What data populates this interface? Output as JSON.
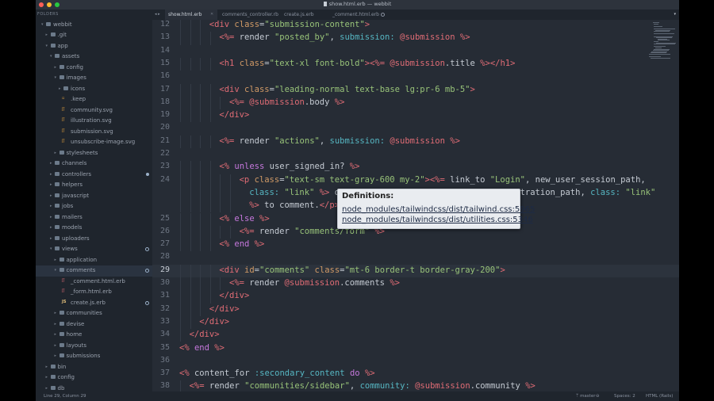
{
  "window": {
    "title": "show.html.erb — webbit"
  },
  "sidebar": {
    "header": "FOLDERS",
    "items": [
      {
        "label": "webbit",
        "kind": "folder",
        "depth": 0,
        "open": true
      },
      {
        "label": ".git",
        "kind": "folder",
        "depth": 1,
        "open": false
      },
      {
        "label": "app",
        "kind": "folder",
        "depth": 1,
        "open": true
      },
      {
        "label": "assets",
        "kind": "folder",
        "depth": 2,
        "open": true
      },
      {
        "label": "config",
        "kind": "folder",
        "depth": 3,
        "open": false
      },
      {
        "label": "images",
        "kind": "folder",
        "depth": 3,
        "open": true
      },
      {
        "label": "icons",
        "kind": "folder",
        "depth": 4,
        "open": false
      },
      {
        "label": ".keep",
        "kind": "file",
        "depth": 4,
        "icon": "file-icon"
      },
      {
        "label": "community.svg",
        "kind": "svg",
        "depth": 4
      },
      {
        "label": "illustration.svg",
        "kind": "svg",
        "depth": 4
      },
      {
        "label": "submission.svg",
        "kind": "svg",
        "depth": 4
      },
      {
        "label": "unsubscribe-image.svg",
        "kind": "svg",
        "depth": 4
      },
      {
        "label": "stylesheets",
        "kind": "folder",
        "depth": 3,
        "open": false
      },
      {
        "label": "channels",
        "kind": "folder",
        "depth": 2,
        "open": false
      },
      {
        "label": "controllers",
        "kind": "folder",
        "depth": 2,
        "open": false,
        "mark": "filled"
      },
      {
        "label": "helpers",
        "kind": "folder",
        "depth": 2,
        "open": false
      },
      {
        "label": "javascript",
        "kind": "folder",
        "depth": 2,
        "open": false
      },
      {
        "label": "jobs",
        "kind": "folder",
        "depth": 2,
        "open": false
      },
      {
        "label": "mailers",
        "kind": "folder",
        "depth": 2,
        "open": false
      },
      {
        "label": "models",
        "kind": "folder",
        "depth": 2,
        "open": false
      },
      {
        "label": "uploaders",
        "kind": "folder",
        "depth": 2,
        "open": false
      },
      {
        "label": "views",
        "kind": "folder",
        "depth": 2,
        "open": true,
        "mark": "hollow"
      },
      {
        "label": "application",
        "kind": "folder",
        "depth": 3,
        "open": false
      },
      {
        "label": "comments",
        "kind": "folder",
        "depth": 3,
        "open": true,
        "mark": "hollow",
        "selected": true
      },
      {
        "label": "_comment.html.erb",
        "kind": "erb",
        "depth": 4
      },
      {
        "label": "_form.html.erb",
        "kind": "erb",
        "depth": 4
      },
      {
        "label": "create.js.erb",
        "kind": "js",
        "depth": 4,
        "mark": "hollow"
      },
      {
        "label": "communities",
        "kind": "folder",
        "depth": 3,
        "open": false
      },
      {
        "label": "devise",
        "kind": "folder",
        "depth": 3,
        "open": false
      },
      {
        "label": "home",
        "kind": "folder",
        "depth": 3,
        "open": false
      },
      {
        "label": "layouts",
        "kind": "folder",
        "depth": 3,
        "open": false
      },
      {
        "label": "submissions",
        "kind": "folder",
        "depth": 3,
        "open": false
      },
      {
        "label": "bin",
        "kind": "folder",
        "depth": 1,
        "open": false
      },
      {
        "label": "config",
        "kind": "folder",
        "depth": 1,
        "open": false
      },
      {
        "label": "db",
        "kind": "folder",
        "depth": 1,
        "open": false
      }
    ]
  },
  "tabs": [
    {
      "label": "show.html.erb",
      "active": true
    },
    {
      "label": "comments_controller.rb",
      "active": false
    },
    {
      "label": "create.js.erb",
      "active": false
    },
    {
      "label": "_comment.html.erb",
      "active": false,
      "dirty": true
    }
  ],
  "editor": {
    "current_line": "29",
    "lines": [
      {
        "n": "12",
        "indent": 3,
        "html": "<span class=\"tg\">&lt;div</span> <span class=\"at\">class</span>=<span class=\"st\">\"submission-content\"</span><span class=\"tg\">&gt;</span>"
      },
      {
        "n": "13",
        "indent": 4,
        "html": "<span class=\"er\">&lt;%=</span> render <span class=\"st\">\"posted_by\"</span>, <span class=\"sy\">submission:</span> <span class=\"iv\">@submission</span> <span class=\"er\">%&gt;</span>"
      },
      {
        "n": "14",
        "indent": 0,
        "html": ""
      },
      {
        "n": "15",
        "indent": 4,
        "html": "<span class=\"tg\">&lt;h1</span> <span class=\"at\">class</span>=<span class=\"st\">\"text-xl font-bold\"</span><span class=\"tg\">&gt;</span><span class=\"er\">&lt;%=</span> <span class=\"iv\">@submission</span>.title <span class=\"er\">%&gt;</span><span class=\"tg\">&lt;/h1&gt;</span>"
      },
      {
        "n": "16",
        "indent": 0,
        "html": ""
      },
      {
        "n": "17",
        "indent": 4,
        "html": "<span class=\"tg\">&lt;div</span> <span class=\"at\">class</span>=<span class=\"st\">\"leading-normal text-base lg:pr-6 mb-5\"</span><span class=\"tg\">&gt;</span>"
      },
      {
        "n": "18",
        "indent": 5,
        "html": "<span class=\"er\">&lt;%=</span> <span class=\"iv\">@submission</span>.body <span class=\"er\">%&gt;</span>"
      },
      {
        "n": "19",
        "indent": 4,
        "html": "<span class=\"tg\">&lt;/div&gt;</span>"
      },
      {
        "n": "20",
        "indent": 0,
        "html": ""
      },
      {
        "n": "21",
        "indent": 4,
        "html": "<span class=\"er\">&lt;%=</span> render <span class=\"st\">\"actions\"</span>, <span class=\"sy\">submission:</span> <span class=\"iv\">@submission</span> <span class=\"er\">%&gt;</span>"
      },
      {
        "n": "22",
        "indent": 0,
        "html": ""
      },
      {
        "n": "23",
        "indent": 4,
        "html": "<span class=\"er\">&lt;%</span> <span class=\"kw\">unless</span> user_signed_in? <span class=\"er\">%&gt;</span>"
      },
      {
        "n": "24",
        "indent": 6,
        "html": "<span class=\"tg\">&lt;p</span> <span class=\"at\">class</span>=<span class=\"st\">\"text-sm text-gray-600 my-2\"</span><span class=\"tg\">&gt;</span><span class=\"er\">&lt;%=</span> link_to <span class=\"st\">\"Login\"</span>, new_user_session_path,"
      },
      {
        "n": "",
        "indent": 7,
        "html": "<span class=\"sy\">class:</span> <span class=\"st\">\"link\"</span> <span class=\"er\">%&gt;</span> or                                   tration_path, <span class=\"sy\">class:</span> <span class=\"st\">\"link\"</span>"
      },
      {
        "n": "",
        "indent": 7,
        "html": "<span class=\"er\">%&gt;</span> to comment.<span class=\"tg\">&lt;/p&gt;</span>"
      },
      {
        "n": "25",
        "indent": 4,
        "html": "<span class=\"er\">&lt;%</span> <span class=\"kw\">else</span> <span class=\"er\">%&gt;</span>"
      },
      {
        "n": "26",
        "indent": 6,
        "html": "<span class=\"er\">&lt;%=</span> render <span class=\"st\">\"comments/form\"</span> <span class=\"er\">%&gt;</span>"
      },
      {
        "n": "27",
        "indent": 4,
        "html": "<span class=\"er\">&lt;%</span> <span class=\"kw\">end</span> <span class=\"er\">%&gt;</span>"
      },
      {
        "n": "28",
        "indent": 0,
        "html": ""
      },
      {
        "n": "29",
        "indent": 4,
        "html": "<span class=\"tg\">&lt;div</span> <span class=\"at\">id</span>=<span class=\"st\">\"comments\"</span> <span class=\"at\">class</span>=<span class=\"st\">\"mt-6 border-t border-gray-200\"</span><span class=\"tg\">&gt;</span>"
      },
      {
        "n": "30",
        "indent": 5,
        "html": "<span class=\"er\">&lt;%=</span> render <span class=\"iv\">@submission</span>.comments <span class=\"er\">%&gt;</span>"
      },
      {
        "n": "31",
        "indent": 4,
        "html": "<span class=\"tg\">&lt;/div&gt;</span>"
      },
      {
        "n": "32",
        "indent": 3,
        "html": "<span class=\"tg\">&lt;/div&gt;</span>"
      },
      {
        "n": "33",
        "indent": 2,
        "html": "<span class=\"tg\">&lt;/div&gt;</span>"
      },
      {
        "n": "34",
        "indent": 1,
        "html": "<span class=\"tg\">&lt;/div&gt;</span>"
      },
      {
        "n": "35",
        "indent": 0,
        "html": "<span class=\"er\">&lt;%</span> <span class=\"kw\">end</span> <span class=\"er\">%&gt;</span>"
      },
      {
        "n": "36",
        "indent": 0,
        "html": ""
      },
      {
        "n": "37",
        "indent": 0,
        "html": "<span class=\"er\">&lt;%</span> content_for <span class=\"sy\">:secondary_content</span> <span class=\"kw\">do</span> <span class=\"er\">%&gt;</span>"
      },
      {
        "n": "38",
        "indent": 1,
        "html": "<span class=\"er\">&lt;%=</span> render <span class=\"st\">\"communities/sidebar\"</span>, <span class=\"sy\">community:</span> <span class=\"iv\">@submission</span>.community <span class=\"er\">%&gt;</span>"
      }
    ]
  },
  "tooltip": {
    "title": "Definitions:",
    "links": [
      "node_modules/tailwindcss/dist/tailwind.css:5965",
      "node_modules/tailwindcss/dist/utilities.css:5346"
    ]
  },
  "statusbar": {
    "position": "Line 29, Column 29",
    "branch": "master",
    "spaces": "Spaces: 2",
    "syntax": "HTML (Rails)"
  },
  "colors": {
    "background": "#262c35",
    "sidebar": "#1f252d",
    "tag": "#e06c75",
    "string": "#98c379",
    "attribute": "#d19a66",
    "keyword": "#c678dd"
  }
}
